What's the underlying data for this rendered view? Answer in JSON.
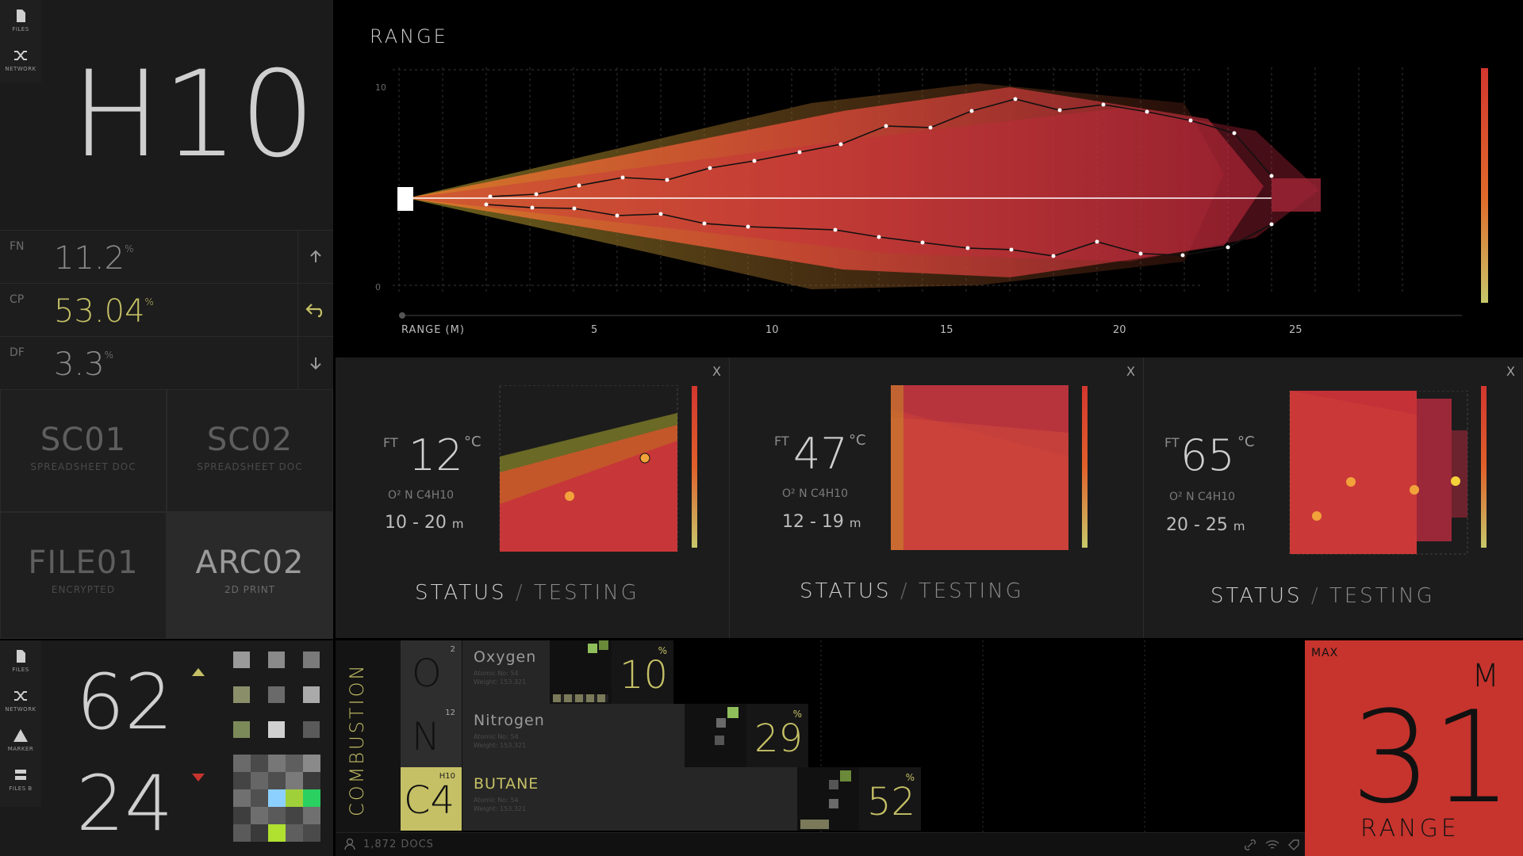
{
  "sidebar_top": {
    "files_label": "FILES",
    "network_label": "NETWORK"
  },
  "device": {
    "title": "H10"
  },
  "stats": [
    {
      "key": "FN",
      "value": "11.2",
      "unit": "%"
    },
    {
      "key": "CP",
      "value": "53.04",
      "unit": "%"
    },
    {
      "key": "DF",
      "value": "3.3",
      "unit": "%"
    }
  ],
  "tiles": [
    {
      "title": "SC01",
      "subtitle": "SPREADSHEET DOC"
    },
    {
      "title": "SC02",
      "subtitle": "SPREADSHEET DOC"
    },
    {
      "title": "FILE01",
      "subtitle": "ENCRYPTED"
    },
    {
      "title": "ARC02",
      "subtitle": "2D PRINT"
    }
  ],
  "range": {
    "title": "RANGE",
    "y_ticks": [
      "10",
      "0"
    ],
    "x_axis_label": "RANGE (M)",
    "x_ticks": [
      "5",
      "10",
      "15",
      "20",
      "25"
    ]
  },
  "cards": [
    {
      "ft": "FT",
      "temp": "12",
      "unit": "°C",
      "gases": "O² N C4H10",
      "range_text": "10 - 20",
      "range_unit": "m",
      "status": "STATUS",
      "sep": "/",
      "state": "TESTING",
      "close": "X"
    },
    {
      "ft": "FT",
      "temp": "47",
      "unit": "°C",
      "gases": "O² N C4H10",
      "range_text": "12 - 19",
      "range_unit": "m",
      "status": "STATUS",
      "sep": "/",
      "state": "TESTING",
      "close": "X"
    },
    {
      "ft": "FT",
      "temp": "65",
      "unit": "°C",
      "gases": "O² N C4H10",
      "range_text": "20 - 25",
      "range_unit": "m",
      "status": "STATUS",
      "sep": "/",
      "state": "TESTING",
      "close": "X"
    }
  ],
  "sidebar_bottom": {
    "files_label": "FILES",
    "network_label": "NETWORK",
    "marker_label": "MARKER",
    "files_b_label": "FILES B"
  },
  "counters": {
    "top": "62",
    "bottom": "24"
  },
  "combustion": {
    "label": "COMBUSTION",
    "elements": [
      {
        "symbol": "O",
        "atomic": "2",
        "name": "Oxygen",
        "meta1": "Atomic No: 54",
        "meta2": "Weight: 153.321",
        "percent": "10",
        "percent_unit": "%"
      },
      {
        "symbol": "N",
        "atomic": "12",
        "name": "Nitrogen",
        "meta1": "Atomic No: 54",
        "meta2": "Weight: 153.321",
        "percent": "29",
        "percent_unit": "%"
      },
      {
        "symbol": "C4",
        "atomic": "H10",
        "name": "BUTANE",
        "meta1": "Atomic No: 54",
        "meta2": "Weight: 153.321",
        "percent": "52",
        "percent_unit": "%"
      }
    ]
  },
  "max_range": {
    "key": "MAX",
    "unit": "M",
    "value": "31",
    "label": "RANGE"
  },
  "footer": {
    "docs": "1,872 DOCS"
  },
  "colors": {
    "accent": "#c5c066",
    "alert": "#c6342d",
    "panel": "#1b1b1b"
  }
}
